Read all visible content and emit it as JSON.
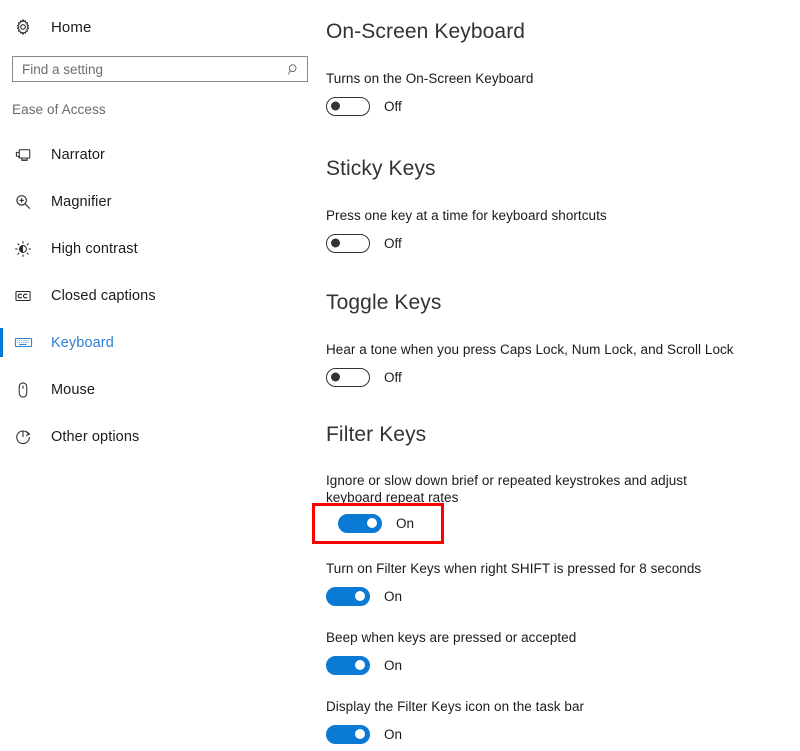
{
  "sidebar": {
    "home": {
      "label": "Home",
      "icon": "gear-icon"
    },
    "search": {
      "value": "",
      "placeholder": "Find a setting",
      "icon": "search-icon"
    },
    "group_label": "Ease of Access",
    "items": [
      {
        "label": "Narrator",
        "icon": "narrator-icon",
        "selected": false
      },
      {
        "label": "Magnifier",
        "icon": "magnifier-icon",
        "selected": false
      },
      {
        "label": "High contrast",
        "icon": "high-contrast-icon",
        "selected": false
      },
      {
        "label": "Closed captions",
        "icon": "closed-captions-icon",
        "selected": false
      },
      {
        "label": "Keyboard",
        "icon": "keyboard-icon",
        "selected": true
      },
      {
        "label": "Mouse",
        "icon": "mouse-icon",
        "selected": false
      },
      {
        "label": "Other options",
        "icon": "other-options-icon",
        "selected": false
      }
    ]
  },
  "main": {
    "sections": [
      {
        "title": "On-Screen Keyboard",
        "settings": [
          {
            "desc": "Turns on the On-Screen Keyboard",
            "state": "Off",
            "on": false
          }
        ]
      },
      {
        "title": "Sticky Keys",
        "settings": [
          {
            "desc": "Press one key at a time for keyboard shortcuts",
            "state": "Off",
            "on": false
          }
        ]
      },
      {
        "title": "Toggle Keys",
        "settings": [
          {
            "desc": "Hear a tone when you press Caps Lock, Num Lock, and Scroll Lock",
            "state": "Off",
            "on": false
          }
        ]
      },
      {
        "title": "Filter Keys",
        "settings": [
          {
            "desc": "Ignore or slow down brief or repeated keystrokes and adjust keyboard repeat rates",
            "state": "On",
            "on": true,
            "highlighted": true
          },
          {
            "desc": "Turn on Filter Keys when right SHIFT is pressed for 8 seconds",
            "state": "On",
            "on": true
          },
          {
            "desc": "Beep when keys are pressed or accepted",
            "state": "On",
            "on": true
          },
          {
            "desc": "Display the Filter Keys icon on the task bar",
            "state": "On",
            "on": true
          }
        ]
      }
    ]
  },
  "colors": {
    "accent": "#0078d7",
    "toggle_on": "#0a7ad4",
    "highlight": "#ff0000",
    "selected_text": "#2d7fd3"
  }
}
